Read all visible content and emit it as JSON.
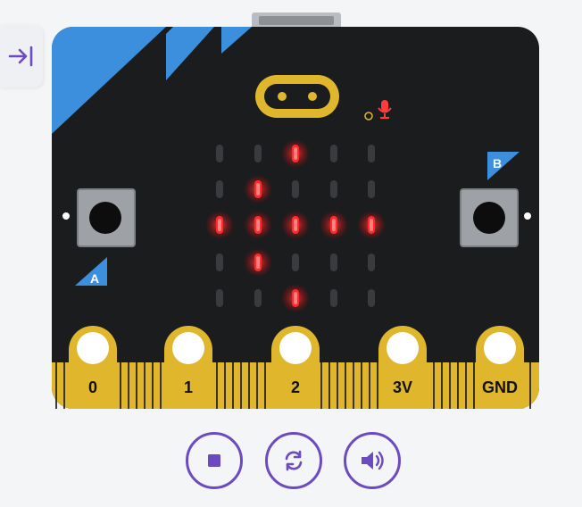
{
  "sidebar": {
    "collapse_icon": "arrow-right-to-bar-icon",
    "accent": "#6c4bc1"
  },
  "board": {
    "name": "micro:bit",
    "board_color": "#1b1c1e",
    "corner_color": "#3b8fdd",
    "gold_color": "#e0b62d",
    "led_on_color": "#ff2a2a",
    "button_a": {
      "label": "A"
    },
    "button_b": {
      "label": "B"
    },
    "pins": [
      {
        "label": "0"
      },
      {
        "label": "1"
      },
      {
        "label": "2"
      },
      {
        "label": "3V"
      },
      {
        "label": "GND"
      }
    ],
    "led_matrix": [
      [
        0,
        0,
        1,
        0,
        0
      ],
      [
        0,
        1,
        0,
        0,
        0
      ],
      [
        1,
        1,
        1,
        1,
        1
      ],
      [
        0,
        1,
        0,
        0,
        0
      ],
      [
        0,
        0,
        1,
        0,
        0
      ]
    ],
    "microphone_icon": "microphone-icon"
  },
  "controls": [
    {
      "name": "stop-button",
      "icon": "stop-icon"
    },
    {
      "name": "restart-button",
      "icon": "restart-icon"
    },
    {
      "name": "mute-button",
      "icon": "speaker-icon"
    }
  ]
}
